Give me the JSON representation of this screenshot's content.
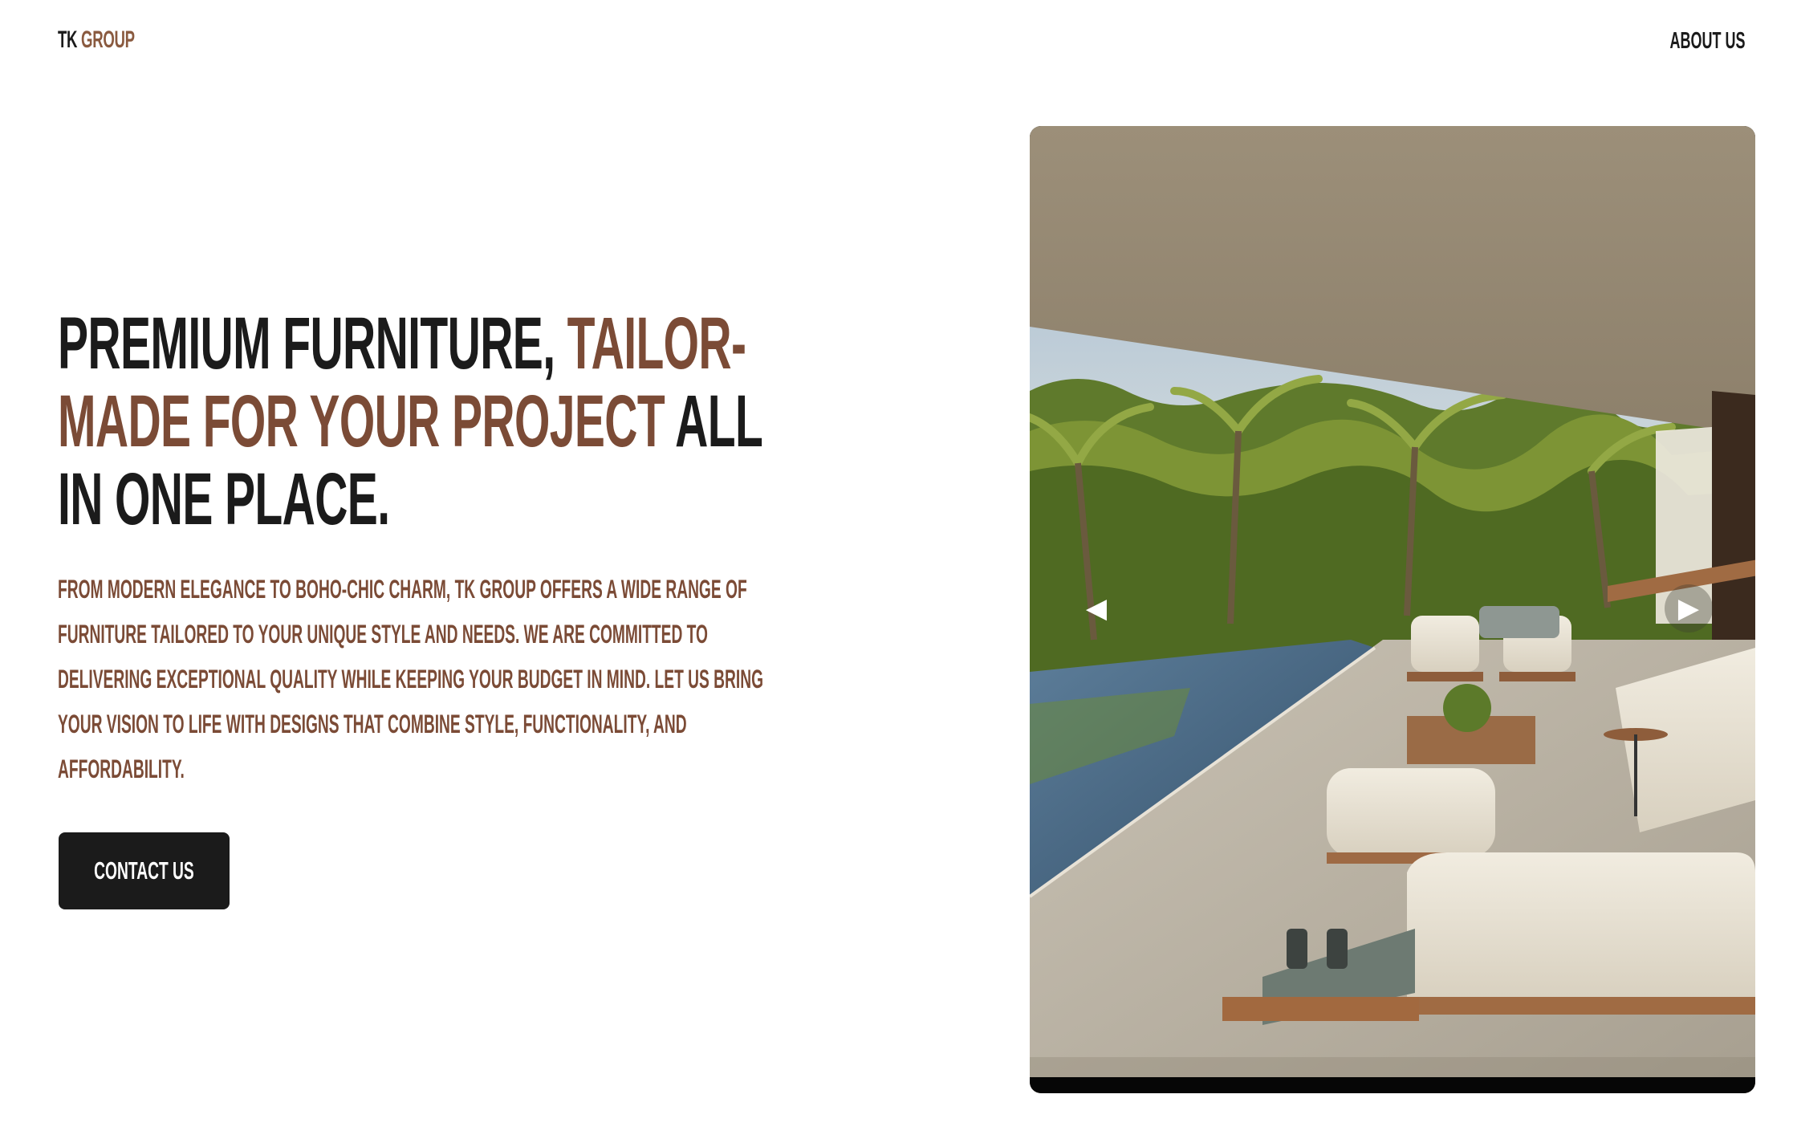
{
  "header": {
    "logo_tk": "TK",
    "logo_group": "GROUP",
    "nav_about": "ABOUT US"
  },
  "hero": {
    "headline_part1": "PREMIUM FURNITURE, ",
    "headline_accent": "TAILOR-MADE FOR YOUR PROJECT",
    "headline_part2": " ALL IN ONE PLACE.",
    "description": "FROM MODERN ELEGANCE TO BOHO-CHIC CHARM, TK GROUP OFFERS A WIDE RANGE OF FURNITURE TAILORED TO YOUR UNIQUE STYLE AND NEEDS. WE ARE COMMITTED TO DELIVERING EXCEPTIONAL QUALITY WHILE KEEPING YOUR BUDGET IN MIND. LET US BRING YOUR VISION TO LIFE WITH DESIGNS THAT COMBINE STYLE, FUNCTIONALITY, AND AFFORDABILITY.",
    "contact_label": "CONTACT US"
  },
  "carousel": {
    "prev_icon": "triangle-left-icon",
    "next_icon": "triangle-right-icon",
    "prev_glyph": "◀",
    "next_glyph": "▶"
  },
  "colors": {
    "accent": "#7b4b36",
    "dark": "#1b1b1b",
    "background": "#ffffff"
  }
}
